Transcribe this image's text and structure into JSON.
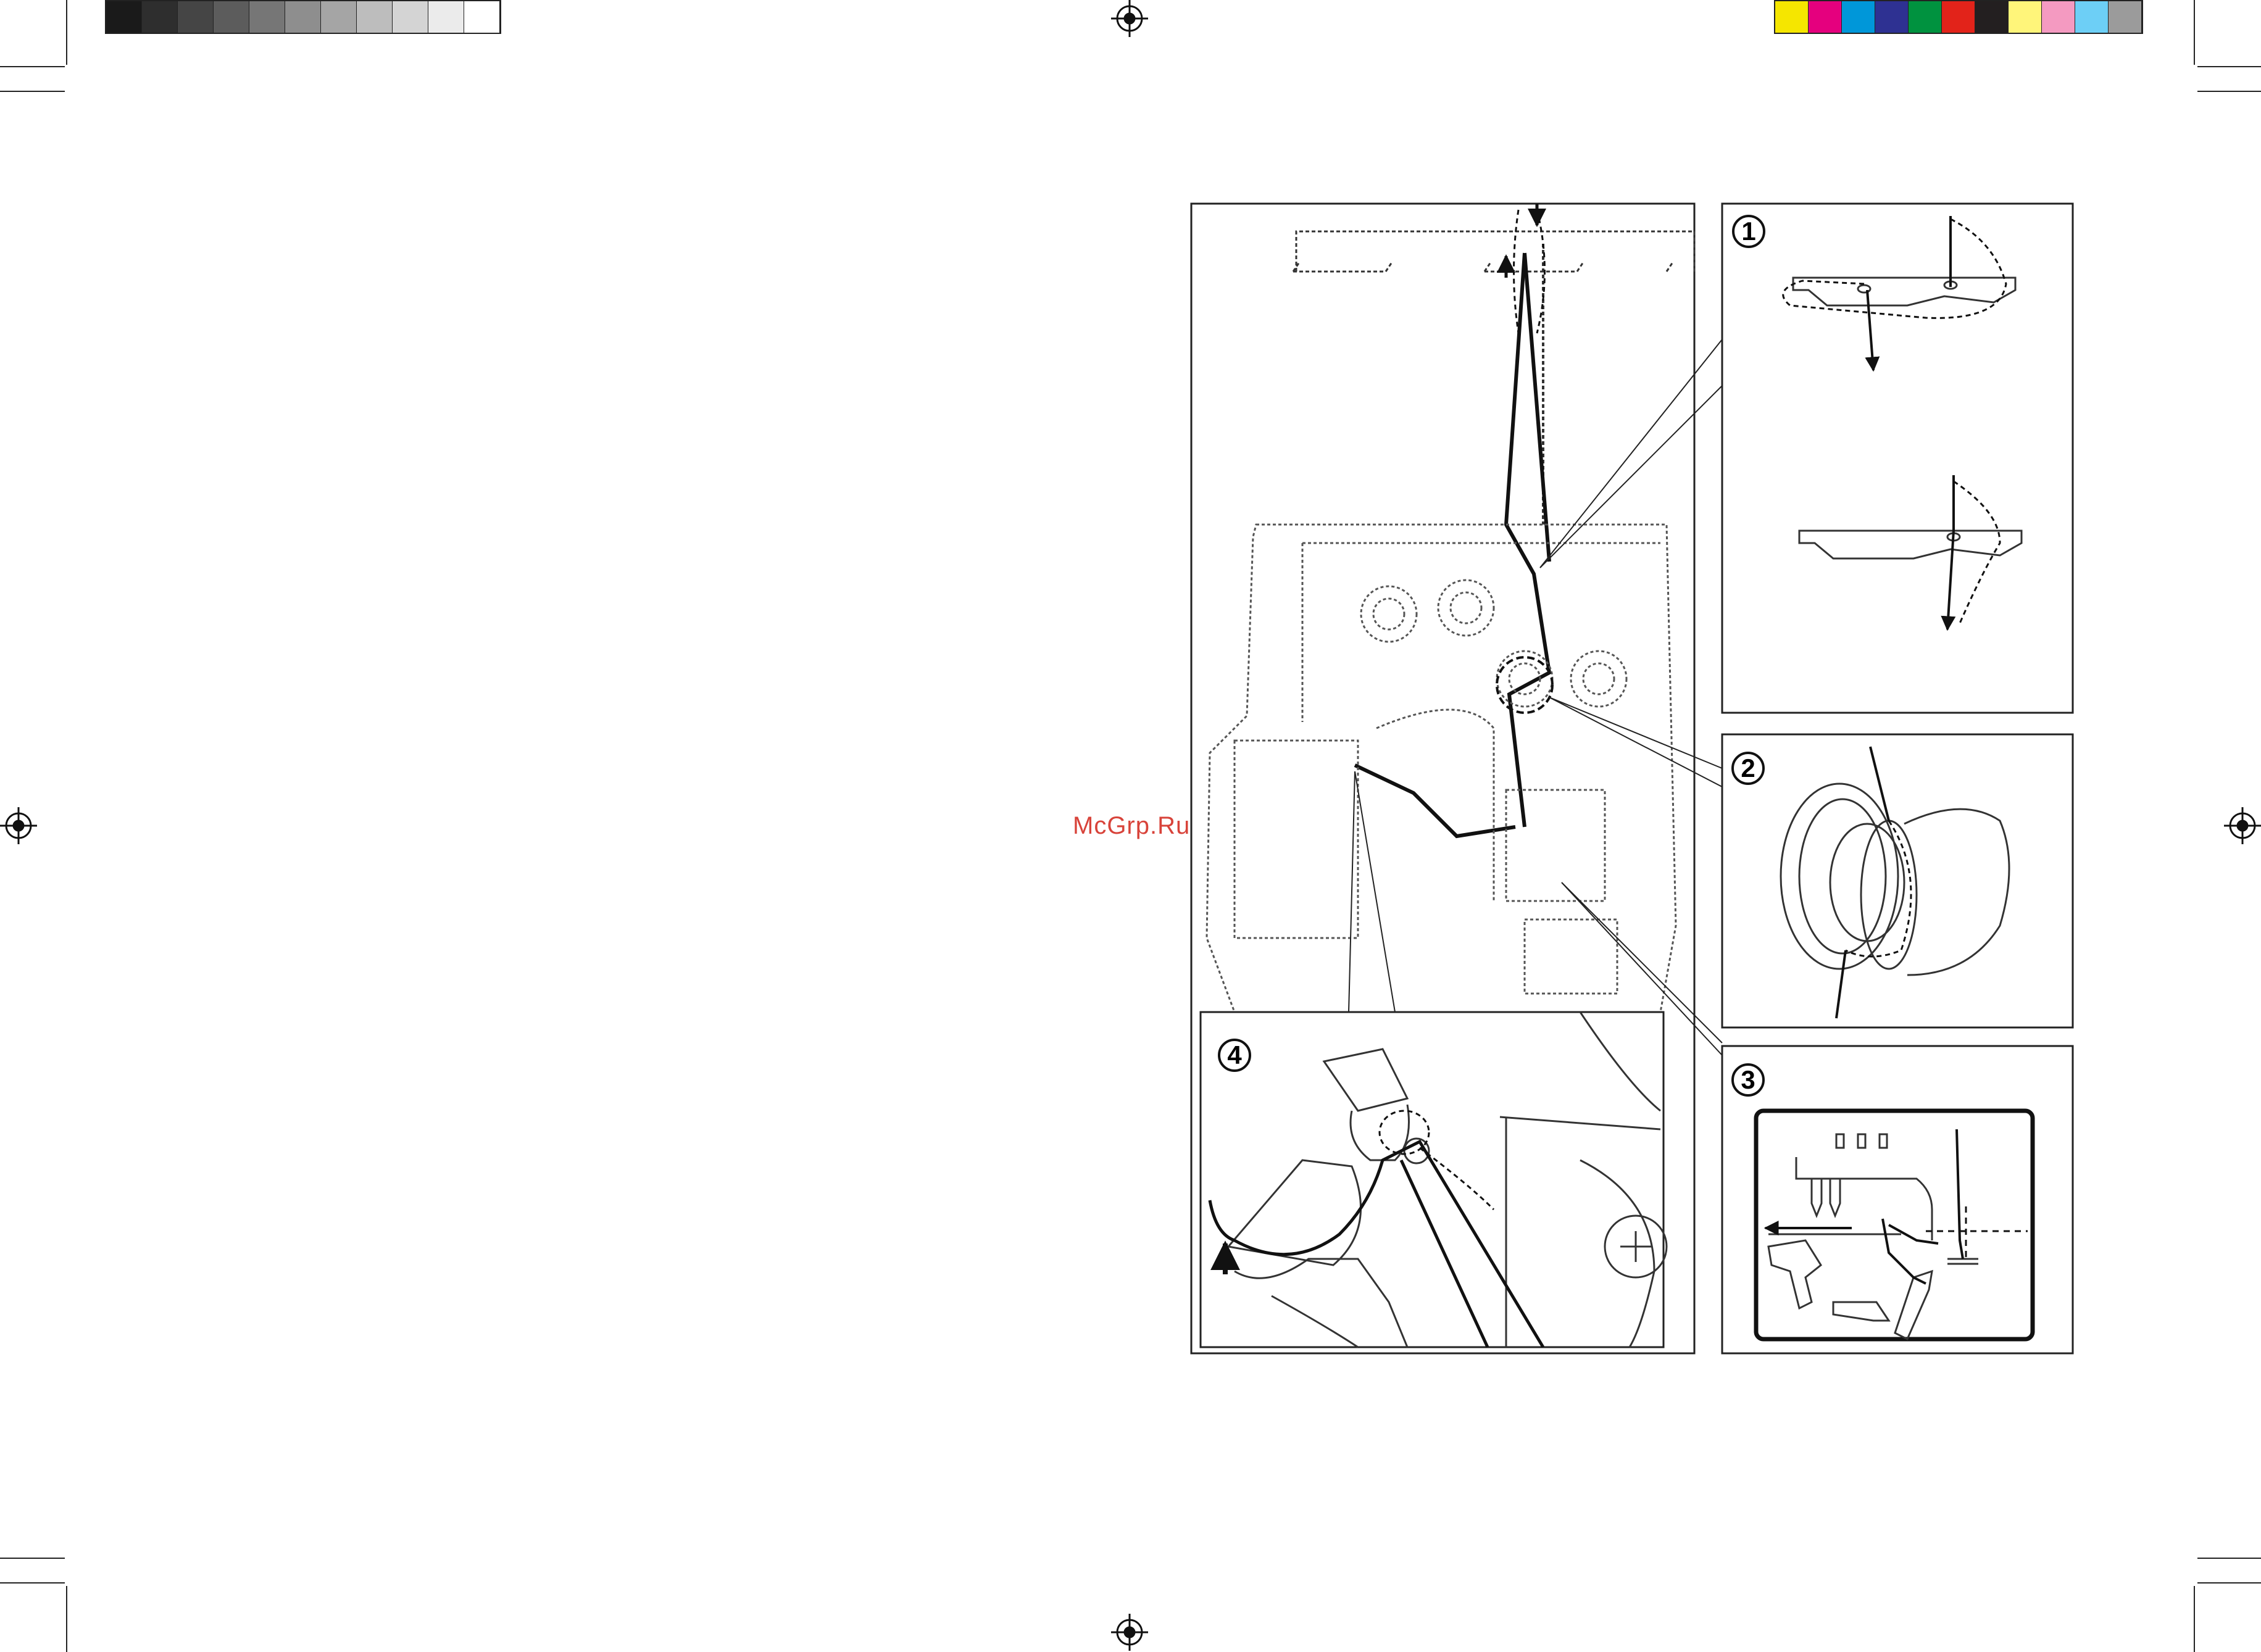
{
  "watermark": {
    "text": "McGrp.Ru"
  },
  "print_marks": {
    "grayscale_swatches": [
      "#1a1a1a",
      "#2e2e2e",
      "#454545",
      "#5c5c5c",
      "#767676",
      "#8e8e8e",
      "#a5a5a5",
      "#bdbdbd",
      "#d4d4d4",
      "#ebebeb",
      "#ffffff"
    ],
    "color_swatches": [
      "#f5e600",
      "#e5007e",
      "#0097d9",
      "#2e3192",
      "#00923f",
      "#e2231a",
      "#231f20",
      "#fff57a",
      "#f49ac1",
      "#6dcff6",
      "#9b9b9b"
    ]
  },
  "callouts": {
    "one": "1",
    "two": "2",
    "three": "3",
    "four": "4"
  },
  "icons": {
    "registration_mark": "registration-target-icon",
    "thread_arrow": "arrow-icon"
  }
}
